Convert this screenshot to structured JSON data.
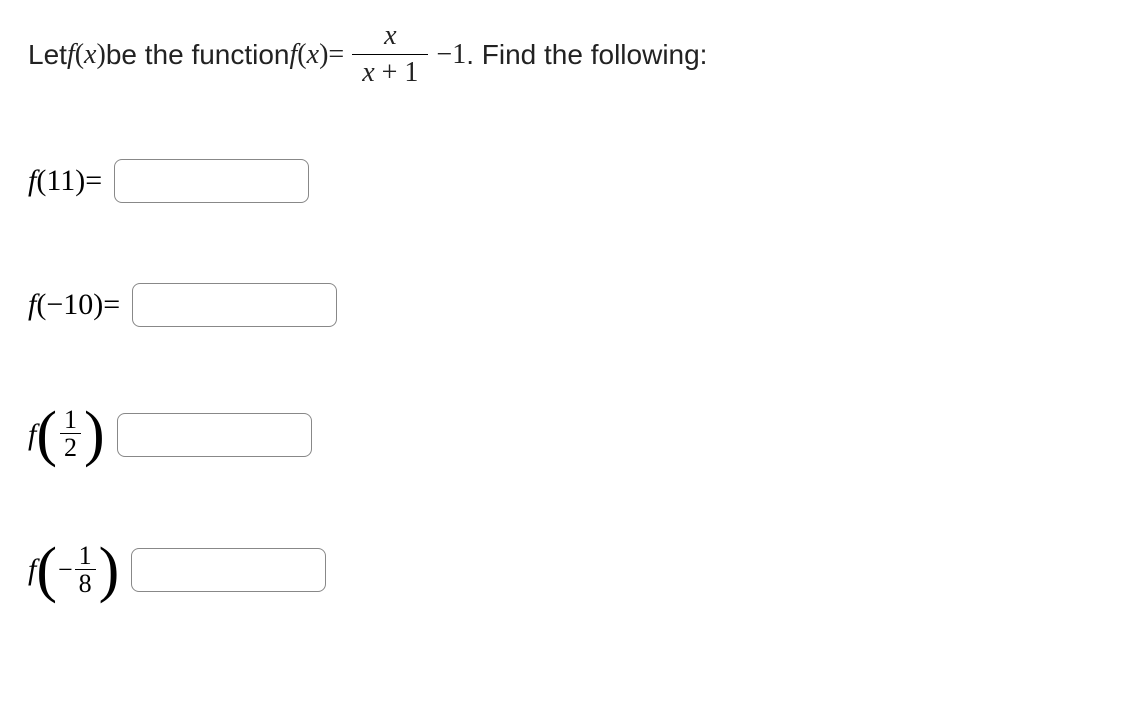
{
  "intro": {
    "prefix": "Let ",
    "fn1_f": "f",
    "fn1_open": "(",
    "fn1_var": "x",
    "fn1_close": ")",
    "middle": " be the function ",
    "fn2_f": "f",
    "fn2_open": "(",
    "fn2_var": "x",
    "fn2_close": ")",
    "eq": " = ",
    "frac_num": "x",
    "frac_den_x": "x",
    "frac_den_plus": " + ",
    "frac_den_one": "1",
    "minus": " − ",
    "one": "1",
    "suffix": ". Find the following:"
  },
  "q1": {
    "f": "f",
    "open": "(",
    "arg": "11",
    "close": ")",
    "eq": " = "
  },
  "q2": {
    "f": "f",
    "open": "(",
    "neg": " − ",
    "arg": "10",
    "close": ")",
    "eq": " = "
  },
  "q3": {
    "f": "f",
    "frac_num": "1",
    "frac_den": "2"
  },
  "q4": {
    "f": "f",
    "neg": " − ",
    "frac_num": "1",
    "frac_den": "8"
  }
}
